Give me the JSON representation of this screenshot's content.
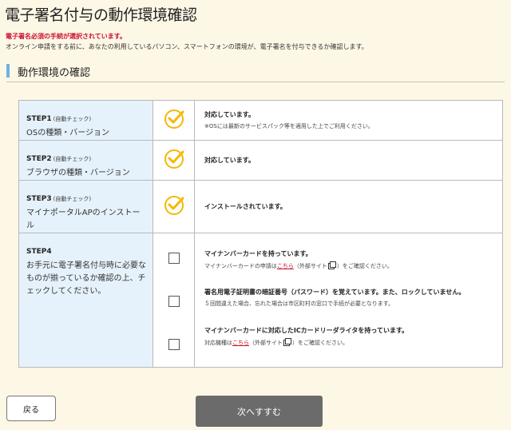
{
  "page": {
    "title": "電子署名付与の動作環境確認",
    "notice_red": "電子署名必須の手続が選択されています。",
    "notice_desc": "オンライン申請をする前に、あなたの利用しているパソコン、スマートフォンの環境が、電子署名を付与できるか確認します。"
  },
  "section": {
    "title": "動作環境の確認"
  },
  "steps": [
    {
      "label": "STEP1",
      "auto": "(自動チェック)",
      "desc": "OSの種類・バージョン",
      "status": "対応しています。",
      "note": "※OSには最新のサービスパック等を適用した上でご利用ください。"
    },
    {
      "label": "STEP2",
      "auto": "(自動チェック)",
      "desc": "ブラウザの種類・バージョン",
      "status": "対応しています。"
    },
    {
      "label": "STEP3",
      "auto": "(自動チェック)",
      "desc": "マイナポータルAPのインストール",
      "status": "インストールされています。"
    }
  ],
  "step4": {
    "label": "STEP4",
    "desc": "お手元に電子署名付与時に必要なものが揃っているか確認の上、チェックしてください。",
    "items": [
      {
        "main": "マイナンバーカードを持っています。",
        "sub_before": "マイナンバーカードの申請は",
        "link": "こちら",
        "sub_after": "（外部サイト",
        "sub_end": "）をご確認ください。"
      },
      {
        "main": "署名用電子証明書の暗証番号（パスワード）を覚えています。また、ロックしていません。",
        "sub": "５回間違えた場合、忘れた場合は市区町村の窓口で手続が必要となります。"
      },
      {
        "main": "マイナンバーカードに対応したICカードリーダライタを持っています。",
        "sub_before": "対応機種は",
        "link": "こちら",
        "sub_after": "（外部サイト",
        "sub_end": "）をご確認ください。"
      }
    ]
  },
  "buttons": {
    "back": "戻る",
    "next": "次へすすむ"
  },
  "colors": {
    "check_icon": "#f5b800",
    "step_bg": "#e6f2fb",
    "accent_bar": "#6fb3df",
    "next_bg": "#6b6b6b",
    "red": "#c8102e"
  }
}
